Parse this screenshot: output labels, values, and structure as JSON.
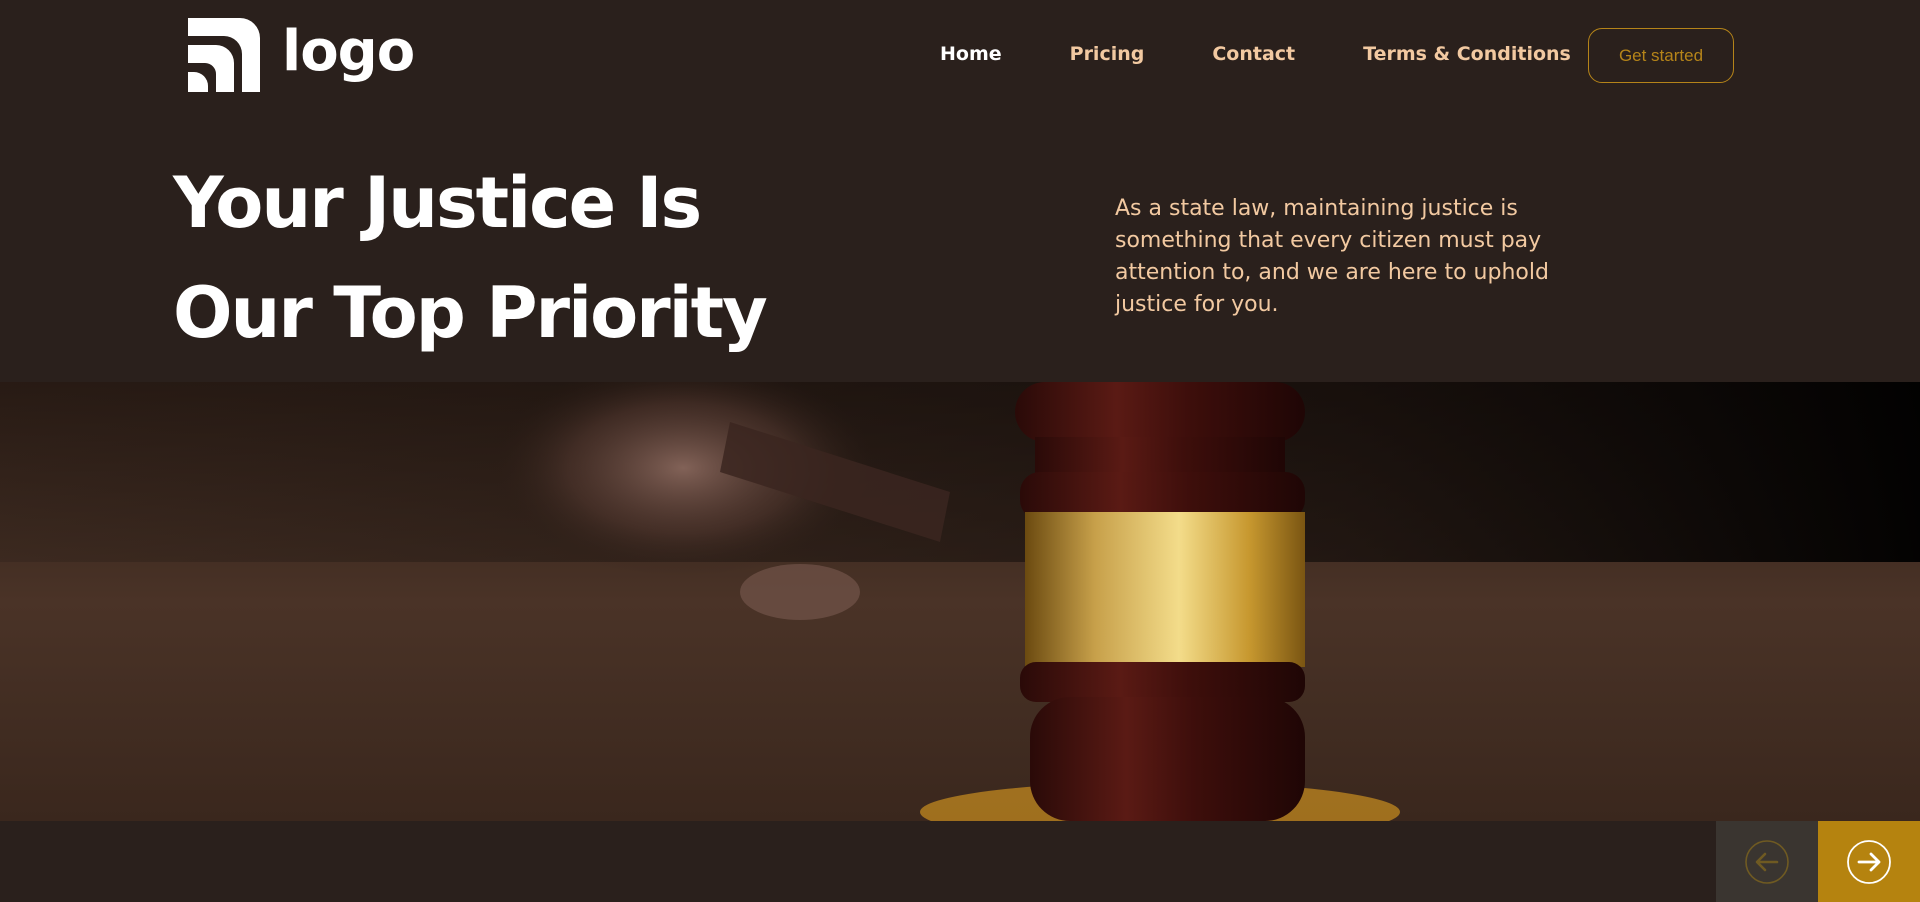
{
  "header": {
    "logo_text": "logo",
    "logo_icon": "signal-arcs-icon",
    "nav": [
      {
        "label": "Home",
        "active": true
      },
      {
        "label": "Pricing",
        "active": false
      },
      {
        "label": "Contact",
        "active": false
      },
      {
        "label": "Terms & Conditions",
        "active": false
      }
    ],
    "cta_label": "Get started"
  },
  "hero": {
    "title_line1": "Your Justice Is",
    "title_line2": "Our Top Priority",
    "description": "As a state law, maintaining justice is something that every citizen must pay attention to, and we are here to uphold justice for you."
  },
  "banner": {
    "image_subject": "gavel-with-gold-band-photo"
  },
  "carousel": {
    "prev_icon": "arrow-left-icon",
    "next_icon": "arrow-right-icon"
  },
  "colors": {
    "background": "#2a201c",
    "accent": "#b5830f",
    "nav_text": "#f2c9a1",
    "heading": "#ffffff"
  }
}
